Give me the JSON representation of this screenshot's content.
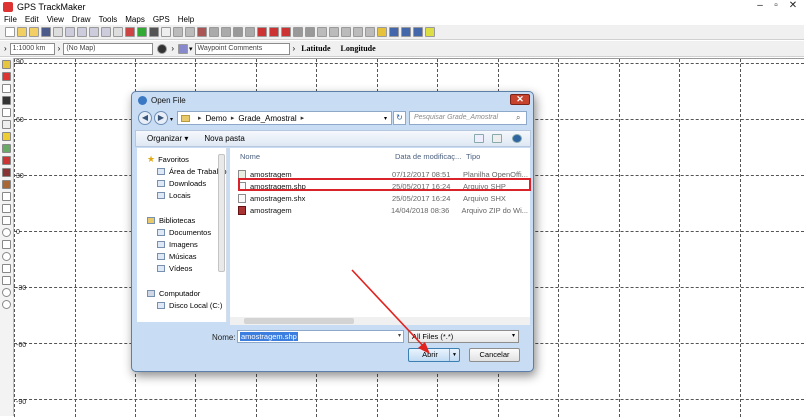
{
  "app": {
    "title": "GPS TrackMaker"
  },
  "menu": [
    "File",
    "Edit",
    "View",
    "Draw",
    "Tools",
    "Maps",
    "GPS",
    "Help"
  ],
  "toolbar2": {
    "scale": "1:1000 km",
    "map_select": "(No Map)",
    "waypoint_comments": "Waypoint Comments",
    "latitude_label": "Latitude",
    "longitude_label": "Longitude"
  },
  "map": {
    "lat_labels": [
      "90",
      "60",
      "30",
      "0",
      "-30",
      "-60",
      "-90"
    ]
  },
  "dialog": {
    "title": "Open File",
    "close_icon": "x-icon",
    "breadcrumb": [
      "Demo",
      "Grade_Amostral"
    ],
    "search_placeholder": "Pesquisar Grade_Amostral",
    "organize": "Organizar",
    "new_folder": "Nova pasta",
    "nav": {
      "favorites": "Favoritos",
      "desktop": "Área de Trabalho",
      "downloads": "Downloads",
      "locais": "Locais",
      "libraries": "Bibliotecas",
      "documents": "Documentos",
      "images": "Imagens",
      "music": "Músicas",
      "videos": "Vídeos",
      "computer": "Computador",
      "local_disk": "Disco Local (C:)"
    },
    "columns": {
      "name": "Nome",
      "date": "Data de modificaç...",
      "type": "Tipo"
    },
    "files": [
      {
        "name": "amostragem",
        "date": "07/12/2017 08:51",
        "type": "Planilha OpenOffi..."
      },
      {
        "name": "amostragem.shp",
        "date": "25/05/2017 16:24",
        "type": "Arquivo SHP"
      },
      {
        "name": "amostragem.shx",
        "date": "25/05/2017 16:24",
        "type": "Arquivo SHX"
      },
      {
        "name": "amostragem",
        "date": "14/04/2018 08:36",
        "type": "Arquivo ZIP do Wi..."
      }
    ],
    "filename_label": "Nome:",
    "filename_value": "amostragem.shp",
    "filter": "All Files (*.*)",
    "open_label": "Abrir",
    "cancel_label": "Cancelar"
  },
  "colors": {
    "highlight_border": "#d9222a",
    "arrow": "#e0231f",
    "selection": "#3c7de0"
  }
}
